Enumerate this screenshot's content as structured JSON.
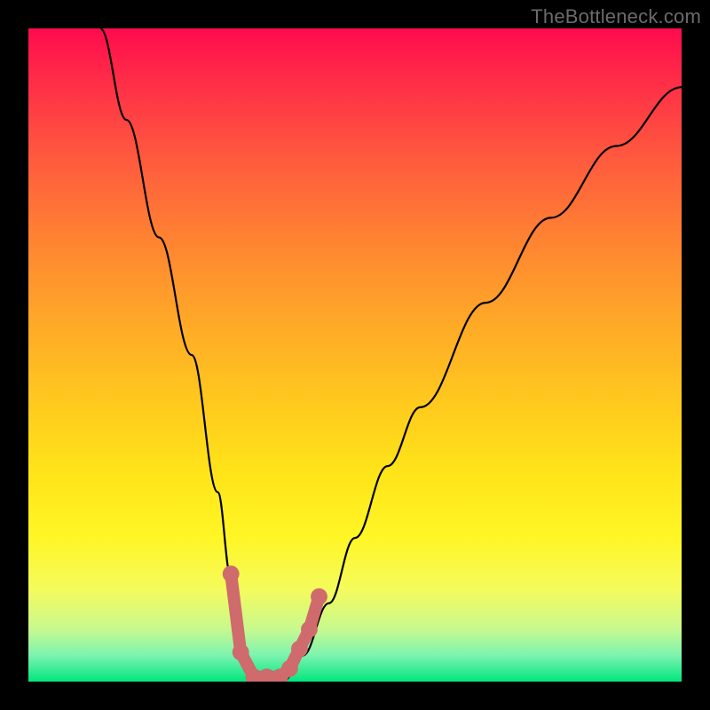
{
  "watermark": "TheBottleneck.com",
  "chart_data": {
    "type": "line",
    "title": "",
    "xlabel": "",
    "ylabel": "",
    "xlim": [
      0,
      100
    ],
    "ylim": [
      0,
      100
    ],
    "series": [
      {
        "name": "bottleneck-curve",
        "x": [
          11,
          15,
          20,
          25,
          29,
          31,
          33,
          35,
          37,
          39,
          42,
          46,
          50,
          55,
          60,
          70,
          80,
          90,
          100
        ],
        "values": [
          100,
          86,
          68,
          50,
          29,
          16,
          4,
          0,
          0,
          0,
          4,
          12,
          22,
          33,
          42,
          58,
          71,
          82,
          91
        ]
      },
      {
        "name": "bottleneck-markers",
        "x": [
          31.0,
          32.5,
          34.5,
          36.5,
          38.5,
          40.0,
          41.5,
          43.0,
          44.5
        ],
        "values": [
          16.5,
          4.5,
          0.7,
          0.7,
          0.7,
          2.0,
          5.0,
          8.0,
          13.0
        ]
      }
    ],
    "marker_color": "#cf6a6d",
    "curve_color": "#000000"
  }
}
